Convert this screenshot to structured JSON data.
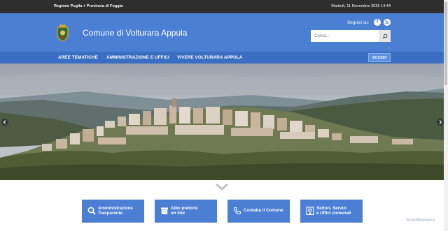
{
  "topbar": {
    "region": "Regione Puglia + Provincia di Foggia",
    "date": "Martedì, 11 Novembre 2025 14:44"
  },
  "header": {
    "title": "Comune di Volturara Appula",
    "seguici": "Seguici su:",
    "search_placeholder": "Cerca..."
  },
  "nav": {
    "items": [
      "AREE TEMATICHE",
      "AMMINISTRAZIONE E UFFICI",
      "VIVERE VOLTURARA APPULA"
    ],
    "login": "ACCEDI"
  },
  "cards": [
    {
      "line1": "Amministrazione",
      "line2": "Trasparente",
      "icon": "search-icon"
    },
    {
      "line1": "Albo pretorio",
      "line2": "on line",
      "icon": "archive-icon"
    },
    {
      "line1": "Contatta il Comune",
      "line2": "",
      "icon": "phone-icon"
    },
    {
      "line1": "Settori, Servizi",
      "line2": "e Uffici comunali",
      "icon": "building-icon"
    }
  ],
  "watermark": "ScanMalware",
  "colors": {
    "header": "#4a7fd4",
    "nav": "#3a6ec2",
    "topbar": "#2e2e2e",
    "card": "#4a7fd4"
  }
}
